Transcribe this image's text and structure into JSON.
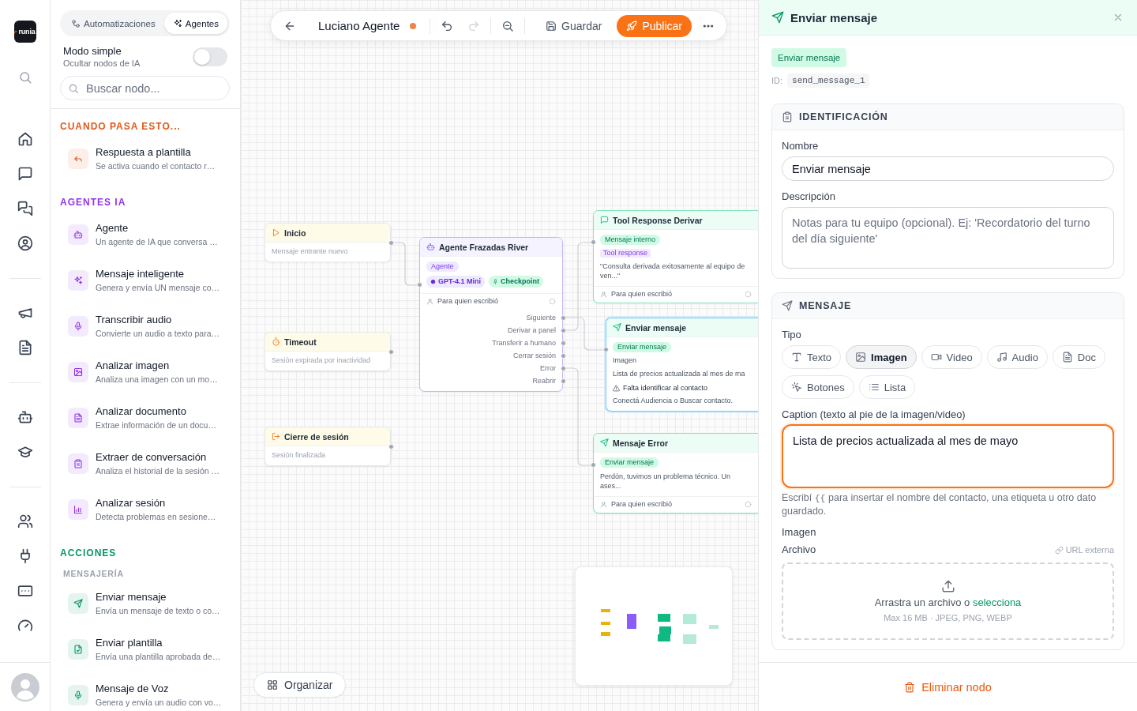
{
  "rail": {
    "logo": "runia"
  },
  "library": {
    "tabs": [
      {
        "label": "Automatizaciones",
        "selected": false
      },
      {
        "label": "Agentes",
        "selected": true
      }
    ],
    "simple_mode": {
      "label": "Modo simple",
      "hint": "Ocultar nodos de IA",
      "on": false
    },
    "search": {
      "placeholder": "Buscar nodo..."
    },
    "sections": [
      {
        "heading": "CUANDO PASA ESTO...",
        "color": "#e0591c",
        "items": [
          {
            "title": "Respuesta a plantilla",
            "description": "Se activa cuando el contacto r…"
          }
        ]
      },
      {
        "heading": "AGENTES IA",
        "color": "#9333ea",
        "items": [
          {
            "title": "Agente",
            "description": "Un agente de IA que conversa …"
          },
          {
            "title": "Mensaje inteligente",
            "description": "Genera y envía UN mensaje co…"
          },
          {
            "title": "Transcribir audio",
            "description": "Convierte un audio a texto para…"
          },
          {
            "title": "Analizar imagen",
            "description": "Analiza una imagen con un mo…"
          },
          {
            "title": "Analizar documento",
            "description": "Extrae información de un docu…"
          },
          {
            "title": "Extraer de conversación",
            "description": "Analiza el historial de la sesión …"
          },
          {
            "title": "Analizar sesión",
            "description": "Detecta problemas en sesione…"
          }
        ]
      },
      {
        "heading": "ACCIONES",
        "color": "#059669",
        "subheading": "MENSAJERÍA",
        "items": [
          {
            "title": "Enviar mensaje",
            "description": "Envía un mensaje de texto o co…"
          },
          {
            "title": "Enviar plantilla",
            "description": "Envía una plantilla aprobada de…"
          },
          {
            "title": "Mensaje de Voz",
            "description": "Genera y envía un audio con vo…"
          }
        ]
      }
    ]
  },
  "toolbar": {
    "title": "Luciano Agente",
    "unsaved": true,
    "actions": [
      {
        "kind": "undo",
        "disabled": false
      },
      {
        "kind": "redo",
        "disabled": true
      },
      {
        "kind": "zoom_out",
        "disabled": false
      }
    ],
    "save": "Guardar",
    "publish": "Publicar"
  },
  "canvas": {
    "nodes": [
      {
        "kind": "trigger",
        "title": "Inicio",
        "subtitle": "Mensaje entrante nuevo",
        "selected": false
      },
      {
        "kind": "trigger",
        "title": "Timeout",
        "subtitle": "Sesión expirada por inactividad",
        "selected": false
      },
      {
        "kind": "trigger",
        "title": "Cierre de sesión",
        "subtitle": "Sesión finalizada",
        "selected": false
      },
      {
        "kind": "agent",
        "title": "Agente Frazadas River",
        "badge": "Agente",
        "model": "GPT-4.1 Mini",
        "checkpoint": "Checkpoint",
        "footer": "Para quien escribió",
        "outputs": [
          "Siguiente",
          "Derivar a panel",
          "Transferir a humano",
          "Cerrar sesión",
          "Error",
          "Reabrir"
        ],
        "selected": false
      },
      {
        "kind": "message",
        "title": "Tool Response Derivar",
        "badge": "Mensaje interno",
        "tag": "Tool response",
        "text": "\"Consulta derivada exitosamente al equipo de ven...\"",
        "footer": "Para quien escribió",
        "selected": false
      },
      {
        "kind": "message",
        "title": "Enviar mensaje",
        "badge": "Enviar mensaje",
        "media": "Imagen",
        "text": "Lista de precios actualizada al mes de ma",
        "warning": "Falta identificar al contacto",
        "warning_hint": "Conectá Audiencia o Buscar contacto.",
        "selected": true
      },
      {
        "kind": "message",
        "title": "Mensaje Error",
        "badge": "Enviar mensaje",
        "text": "Perdón, tuvimos un problema técnico. Un ases...",
        "footer": "Para quien escribió",
        "selected": false
      }
    ],
    "organize": "Organizar"
  },
  "panel": {
    "title": "Enviar mensaje",
    "badge": "Enviar mensaje",
    "id_label": "ID:",
    "id": "send_message_1",
    "identification": {
      "heading": "IDENTIFICACIÓN",
      "name_label": "Nombre",
      "name_value": "Enviar mensaje",
      "description_label": "Descripción",
      "description_placeholder": "Notas para tu equipo (opcional). Ej: 'Recordatorio del turno del día siguiente'"
    },
    "message": {
      "heading": "MENSAJE",
      "type_label": "Tipo",
      "types": [
        {
          "label": "Texto",
          "selected": false
        },
        {
          "label": "Imagen",
          "selected": true
        },
        {
          "label": "Video",
          "selected": false
        },
        {
          "label": "Audio",
          "selected": false
        },
        {
          "label": "Doc",
          "selected": false
        },
        {
          "label": "Botones",
          "selected": false
        },
        {
          "label": "Lista",
          "selected": false
        }
      ],
      "caption_label": "Caption (texto al pie de la imagen/video)",
      "caption_value": "Lista de precios actualizada al mes de mayo",
      "caption_focused": true,
      "hint": {
        "before": "Escribí",
        "code": "{{",
        "after": "para insertar el nombre del contacto, una etiqueta u otro dato guardado."
      },
      "image_label": "Imagen",
      "file_label": "Archivo",
      "external_url": "URL externa",
      "drop_text": "Arrastra un archivo o",
      "drop_link": "selecciona",
      "drop_limits": "Max 16 MB · JPEG, PNG, WEBP"
    },
    "delete": "Eliminar nodo"
  }
}
